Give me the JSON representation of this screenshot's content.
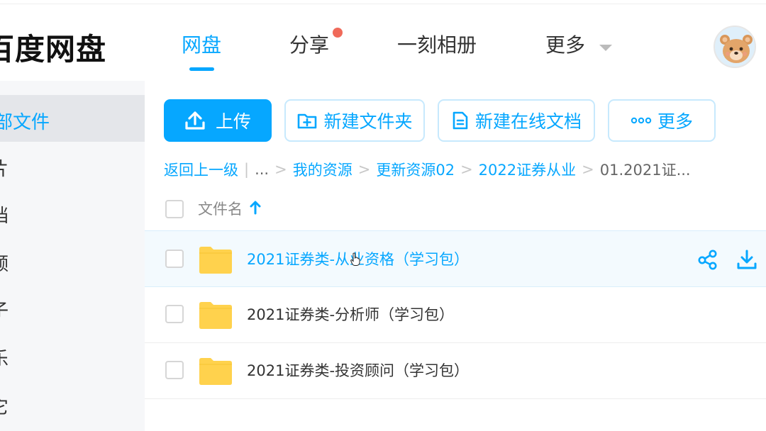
{
  "app": {
    "logo": "百度网盘",
    "nav": [
      "网盘",
      "分享",
      "一刻相册",
      "更多"
    ]
  },
  "sidebar": {
    "items": [
      "部文件",
      "片",
      "档",
      "频",
      "子",
      "乐",
      "它"
    ]
  },
  "toolbar": {
    "upload": "上传",
    "new_folder": "新建文件夹",
    "new_doc": "新建在线文档",
    "more": "更多"
  },
  "breadcrumb": {
    "back": "返回上一级",
    "divider": "|",
    "ellipsis": "...",
    "sep": ">",
    "items": [
      "我的资源",
      "更新资源02",
      "2022证券从业"
    ],
    "current": "01.2021证..."
  },
  "table": {
    "column_name": "文件名",
    "rows": [
      {
        "name": "2021证券类-从业资格（学习包）"
      },
      {
        "name": "2021证券类-分析师（学习包）"
      },
      {
        "name": "2021证券类-投资顾问（学习包）"
      }
    ]
  },
  "colors": {
    "accent": "#06a7ff",
    "folder": "#ffd24d",
    "notify_dot": "#f06a5a"
  },
  "icons": [
    "upload-icon",
    "new-folder-icon",
    "document-icon",
    "more-dots-icon",
    "sort-up-icon",
    "folder-icon",
    "share-icon",
    "download-icon",
    "chevron-down-icon"
  ]
}
